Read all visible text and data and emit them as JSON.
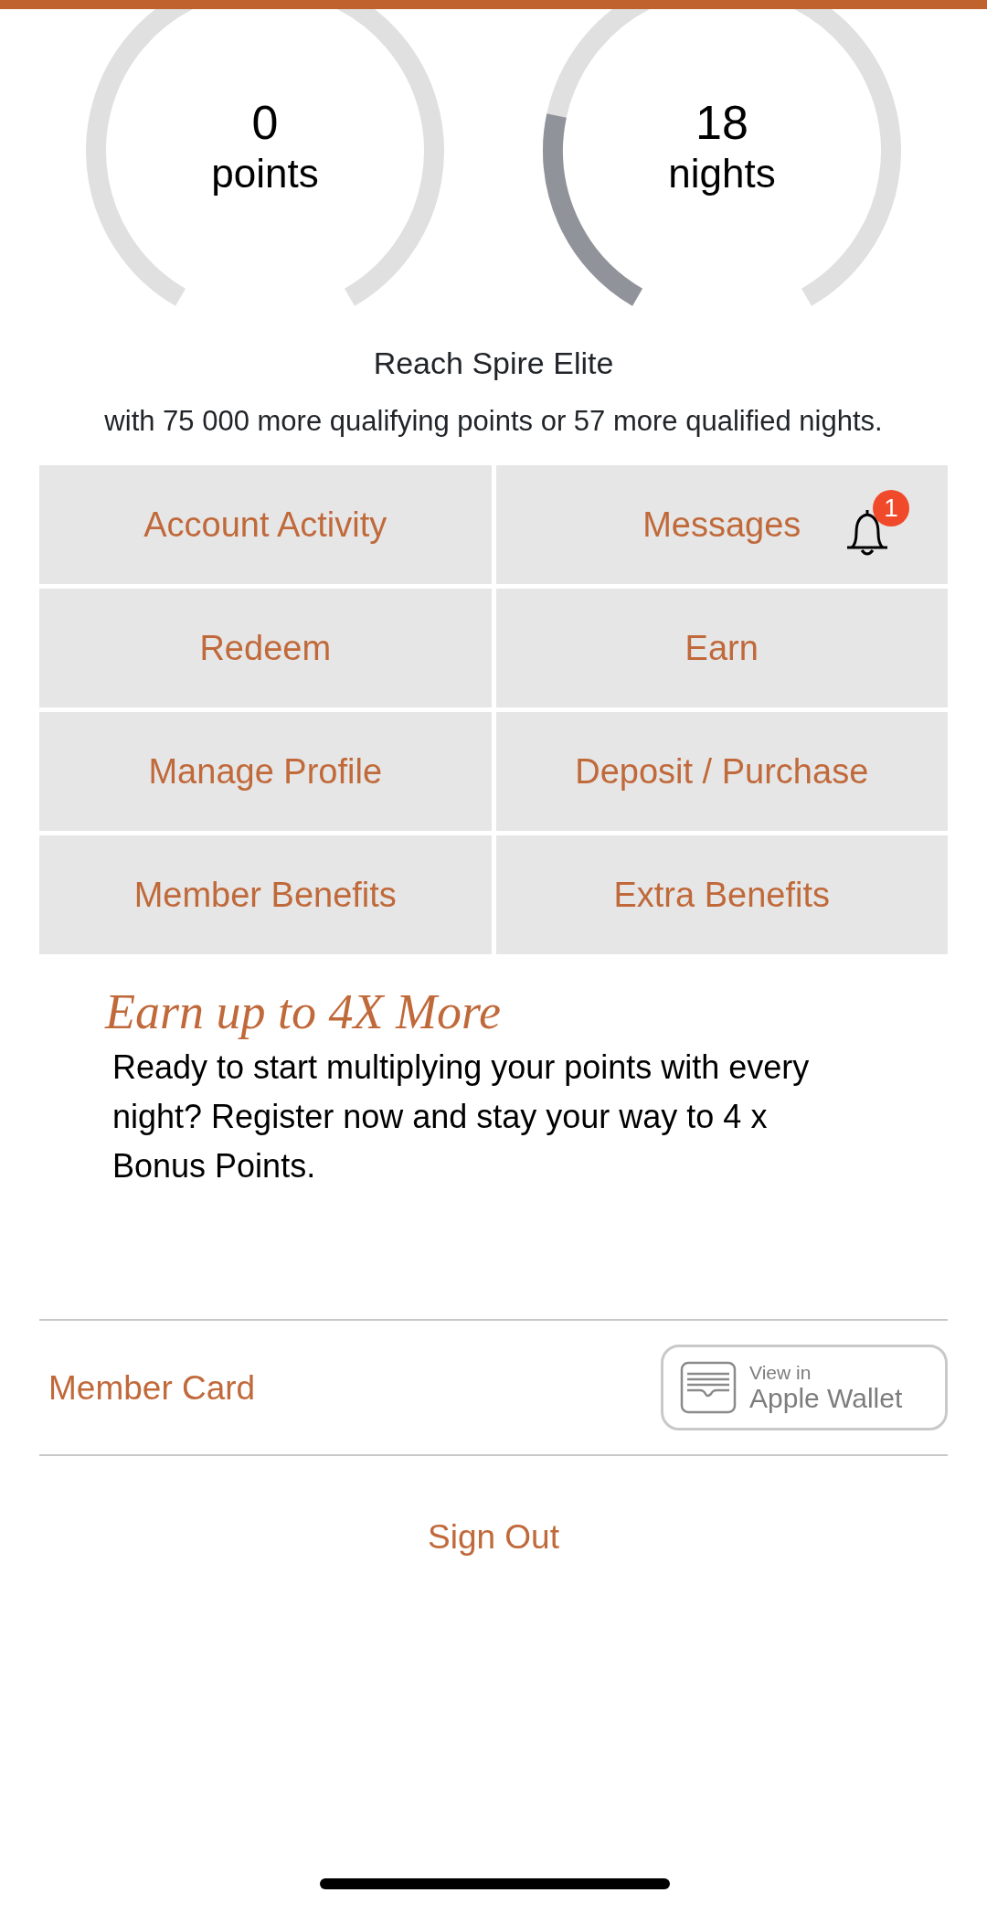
{
  "gauges": [
    {
      "value": "0",
      "unit": "points"
    },
    {
      "value": "18",
      "unit": "nights"
    }
  ],
  "goal": {
    "title": "Reach Spire Elite",
    "text": "with 75 000 more qualifying points or 57 more qualified nights."
  },
  "tiles": [
    {
      "label": "Account Activity"
    },
    {
      "label": "Messages",
      "badge": "1"
    },
    {
      "label": "Redeem"
    },
    {
      "label": "Earn"
    },
    {
      "label": "Manage Profile"
    },
    {
      "label": "Deposit / Purchase"
    },
    {
      "label": "Member Benefits"
    },
    {
      "label": "Extra Benefits"
    }
  ],
  "promo": {
    "title": "Earn up to 4X More",
    "text": "Ready to start multiplying your points with every night? Register now and stay your way to 4 x Bonus Points."
  },
  "member_card": {
    "label": "Member Card",
    "wallet_line1": "View in",
    "wallet_line2": "Apple Wallet"
  },
  "sign_out": "Sign Out"
}
